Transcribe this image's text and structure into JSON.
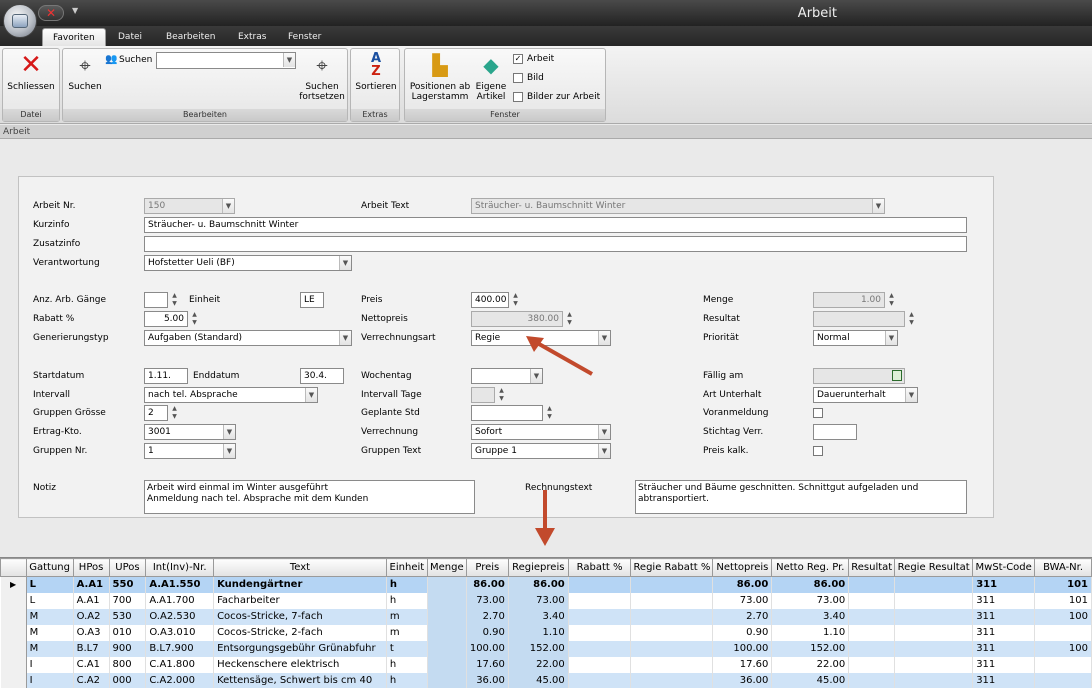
{
  "window": {
    "title": "Arbeit"
  },
  "tabs": [
    "Favoriten",
    "Datei",
    "Bearbeiten",
    "Extras",
    "Fenster"
  ],
  "ribbon": {
    "close_label": "Schliessen",
    "search_label": "Suchen",
    "search_field_label": "Suchen",
    "search_next_label": "Suchen fortsetzen",
    "sort_label": "Sortieren",
    "positions_label": "Positionen ab Lagerstamm",
    "own_article_label": "Eigene Artikel",
    "check_arbeit": "Arbeit",
    "check_bild": "Bild",
    "check_bilder": "Bilder zur Arbeit",
    "groups": {
      "datei": "Datei",
      "bearbeiten": "Bearbeiten",
      "extras": "Extras",
      "fenster": "Fenster"
    }
  },
  "strip_label": "Arbeit",
  "form": {
    "arbeit_nr_label": "Arbeit Nr.",
    "arbeit_nr": "150",
    "arbeit_text_label": "Arbeit Text",
    "arbeit_text": "Sträucher- u. Baumschnitt Winter",
    "kurzinfo_label": "Kurzinfo",
    "kurzinfo": "Sträucher- u. Baumschnitt Winter",
    "zusatzinfo_label": "Zusatzinfo",
    "zusatzinfo": "",
    "verantwortung_label": "Verantwortung",
    "verantwortung": "Hofstetter Ueli (BF)",
    "anz_label": "Anz. Arb. Gänge",
    "anz": "",
    "einheit_label": "Einheit",
    "einheit": "LE",
    "preis_label": "Preis",
    "preis": "400.00",
    "menge_label": "Menge",
    "menge": "1.00",
    "rabatt_label": "Rabatt %",
    "rabatt": "5.00",
    "nettopreis_label": "Nettopreis",
    "nettopreis": "380.00",
    "resultat_label": "Resultat",
    "resultat": "",
    "gentyp_label": "Generierungstyp",
    "gentyp": "Aufgaben (Standard)",
    "verrart_label": "Verrechnungsart",
    "verrart": "Regie",
    "prio_label": "Priorität",
    "prio": "Normal",
    "startdatum_label": "Startdatum",
    "startdatum": "1.11.",
    "enddatum_label": "Enddatum",
    "enddatum": "30.4.",
    "wochentag_label": "Wochentag",
    "wochentag": "",
    "faellig_label": "Fällig am",
    "faellig": "",
    "intervall_label": "Intervall",
    "intervall": "nach tel. Absprache",
    "intervall_tage_label": "Intervall Tage",
    "intervall_tage": "",
    "art_unterhalt_label": "Art Unterhalt",
    "art_unterhalt": "Dauerunterhalt",
    "gruppen_groesse_label": "Gruppen Grösse",
    "gruppen_groesse": "2",
    "geplante_std_label": "Geplante Std",
    "geplante_std": "",
    "voranmeldung_label": "Voranmeldung",
    "ertrag_label": "Ertrag-Kto.",
    "ertrag": "3001",
    "verrechnung_label": "Verrechnung",
    "verrechnung": "Sofort",
    "stichtag_label": "Stichtag Verr.",
    "stichtag": "",
    "gruppen_nr_label": "Gruppen Nr.",
    "gruppen_nr": "1",
    "gruppen_text_label": "Gruppen Text",
    "gruppen_text": "Gruppe 1",
    "preis_kalk_label": "Preis kalk.",
    "notiz_label": "Notiz",
    "notiz_line1": "Arbeit wird einmal im Winter ausgeführt",
    "notiz_line2": "Anmeldung nach tel. Absprache mit dem Kunden",
    "rechnungstext_label": "Rechnungstext",
    "rechnungstext": "Sträucher und Bäume geschnitten. Schnittgut aufgeladen und abtransportiert."
  },
  "grid": {
    "headers": [
      "Gattung",
      "HPos",
      "UPos",
      "Int(Inv)-Nr.",
      "Text",
      "Einheit",
      "Menge",
      "Preis",
      "Regiepreis",
      "Rabatt %",
      "Regie Rabatt %",
      "Nettopreis",
      "Netto Reg. Pr.",
      "Resultat",
      "Regie Resultat",
      "MwSt-Code",
      "BWA-Nr."
    ],
    "rows": [
      [
        "L",
        "A.A1",
        "550",
        "A.A1.550",
        "Kundengärtner",
        "h",
        "",
        "86.00",
        "86.00",
        "",
        "",
        "86.00",
        "86.00",
        "",
        "",
        "311",
        "101"
      ],
      [
        "L",
        "A.A1",
        "700",
        "A.A1.700",
        "Facharbeiter",
        "h",
        "",
        "73.00",
        "73.00",
        "",
        "",
        "73.00",
        "73.00",
        "",
        "",
        "311",
        "101"
      ],
      [
        "M",
        "O.A2",
        "530",
        "O.A2.530",
        "Cocos-Stricke, 7-fach",
        "m",
        "",
        "2.70",
        "3.40",
        "",
        "",
        "2.70",
        "3.40",
        "",
        "",
        "311",
        "100"
      ],
      [
        "M",
        "O.A3",
        "010",
        "O.A3.010",
        "Cocos-Stricke, 2-fach",
        "m",
        "",
        "0.90",
        "1.10",
        "",
        "",
        "0.90",
        "1.10",
        "",
        "",
        "311",
        ""
      ],
      [
        "M",
        "B.L7",
        "900",
        "B.L7.900",
        "Entsorgungsgebühr Grünabfuhr",
        "t",
        "",
        "100.00",
        "152.00",
        "",
        "",
        "100.00",
        "152.00",
        "",
        "",
        "311",
        "100"
      ],
      [
        "I",
        "C.A1",
        "800",
        "C.A1.800",
        "Heckenschere elektrisch",
        "h",
        "",
        "17.60",
        "22.00",
        "",
        "",
        "17.60",
        "22.00",
        "",
        "",
        "311",
        ""
      ],
      [
        "I",
        "C.A2",
        "000",
        "C.A2.000",
        "Kettensäge, Schwert bis cm 40",
        "h",
        "",
        "36.00",
        "45.00",
        "",
        "",
        "36.00",
        "45.00",
        "",
        "",
        "311",
        ""
      ]
    ]
  }
}
